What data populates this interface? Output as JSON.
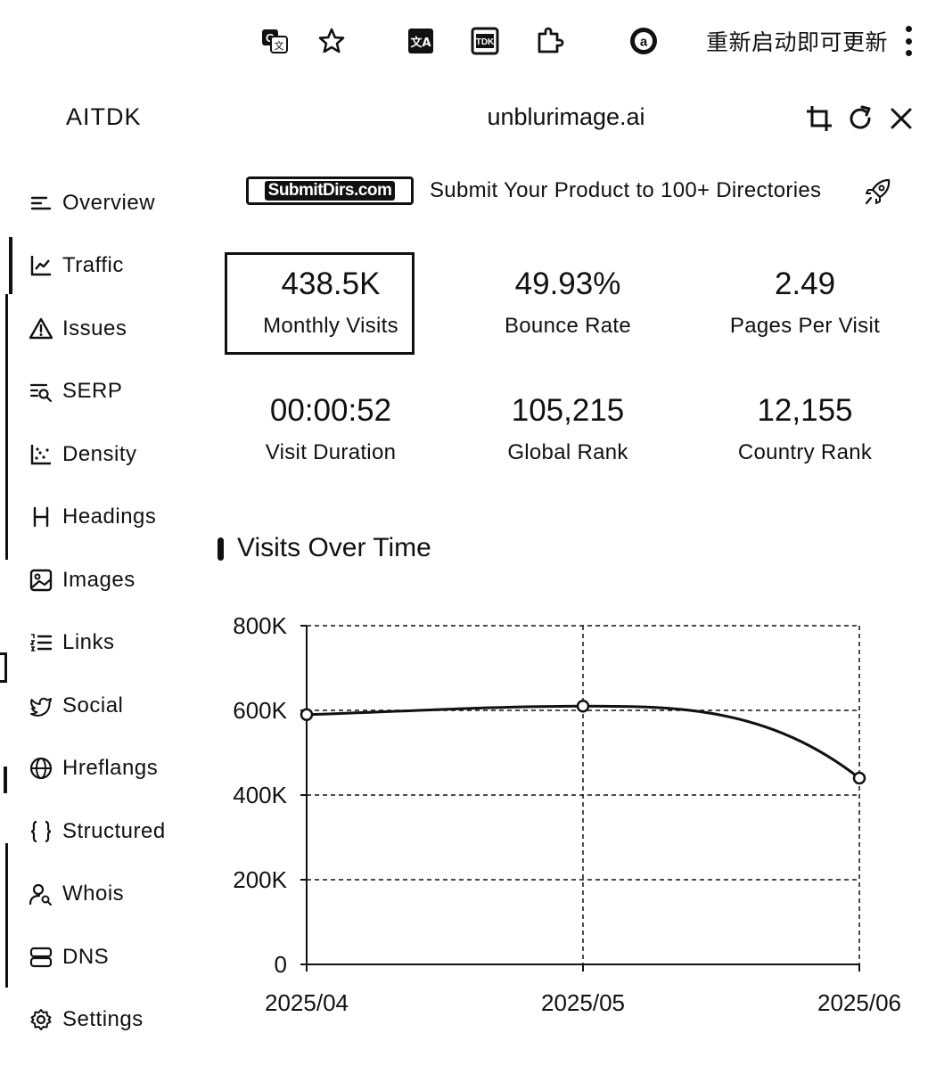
{
  "browser_toolbar": {
    "update_text": "重新启动即可更新",
    "icons": [
      "translate-icon",
      "star-icon",
      "extension-text-icon",
      "extension-tdk-icon",
      "extensions-puzzle-icon",
      "account-icon",
      "more-vert-icon"
    ]
  },
  "header": {
    "brand": "AITDK",
    "domain": "unblurimage.ai",
    "icons": [
      "crop-icon",
      "refresh-icon",
      "close-icon"
    ]
  },
  "sidebar": {
    "items": [
      {
        "label": "Overview",
        "icon": "overview-icon"
      },
      {
        "label": "Traffic",
        "icon": "chart-line-icon"
      },
      {
        "label": "Issues",
        "icon": "warning-icon"
      },
      {
        "label": "SERP",
        "icon": "serp-icon"
      },
      {
        "label": "Density",
        "icon": "density-icon"
      },
      {
        "label": "Headings",
        "icon": "heading-icon"
      },
      {
        "label": "Images",
        "icon": "image-icon"
      },
      {
        "label": "Links",
        "icon": "list-icon"
      },
      {
        "label": "Social",
        "icon": "twitter-icon"
      },
      {
        "label": "Hreflangs",
        "icon": "globe-icon"
      },
      {
        "label": "Structured",
        "icon": "braces-icon"
      },
      {
        "label": "Whois",
        "icon": "user-search-icon"
      },
      {
        "label": "DNS",
        "icon": "server-icon"
      },
      {
        "label": "Settings",
        "icon": "gear-icon"
      }
    ]
  },
  "promo": {
    "badge": "SubmitDirs.com",
    "text": "Submit Your Product to 100+ Directories",
    "icon": "rocket-icon"
  },
  "stats": [
    {
      "value": "438.5K",
      "label": "Monthly Visits"
    },
    {
      "value": "49.93%",
      "label": "Bounce Rate"
    },
    {
      "value": "2.49",
      "label": "Pages Per Visit"
    },
    {
      "value": "00:00:52",
      "label": "Visit Duration"
    },
    {
      "value": "105,215",
      "label": "Global Rank"
    },
    {
      "value": "12,155",
      "label": "Country Rank"
    }
  ],
  "visits_section": {
    "title": "Visits Over Time"
  },
  "chart_data": {
    "type": "line",
    "title": "Visits Over Time",
    "categories": [
      "2025/04",
      "2025/05",
      "2025/06"
    ],
    "series": [
      {
        "values": [
          590000,
          610000,
          440000
        ]
      }
    ],
    "ylim": [
      0,
      800000
    ],
    "yticks": [
      0,
      200000,
      400000,
      600000,
      800000
    ],
    "ytick_labels": [
      "0",
      "200K",
      "400K",
      "600K",
      "800K"
    ],
    "grid": true,
    "legend": "none",
    "line_color": "#111111"
  }
}
